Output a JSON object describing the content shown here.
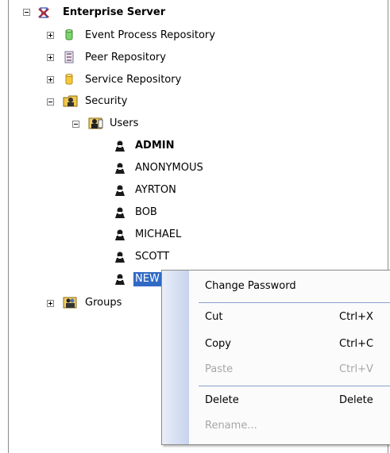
{
  "tree": {
    "root": {
      "label": "Enterprise Server",
      "icon": "enterprise-server-icon",
      "expanded": true
    },
    "repositories": [
      {
        "label": "Event Process Repository",
        "icon": "green-cylinder-icon"
      },
      {
        "label": "Peer Repository",
        "icon": "peer-repository-icon"
      },
      {
        "label": "Service Repository",
        "icon": "yellow-cylinder-icon"
      }
    ],
    "security": {
      "label": "Security",
      "icon": "security-folder-icon",
      "users": {
        "label": "Users",
        "icon": "users-folder-icon",
        "items": [
          "ADMIN",
          "ANONYMOUS",
          "AYRTON",
          "BOB",
          "MICHAEL",
          "SCOTT"
        ],
        "new_item": "NEW"
      },
      "groups": {
        "label": "Groups",
        "icon": "groups-folder-icon"
      }
    }
  },
  "context_menu": {
    "change_password": "Change Password",
    "cut": "Cut",
    "cut_shortcut": "Ctrl+X",
    "copy": "Copy",
    "copy_shortcut": "Ctrl+C",
    "paste": "Paste",
    "paste_shortcut": "Ctrl+V",
    "delete": "Delete",
    "delete_shortcut": "Delete",
    "rename": "Rename..."
  },
  "colors": {
    "selection": "#316ac5",
    "disabled_text": "#a7a7a7"
  }
}
